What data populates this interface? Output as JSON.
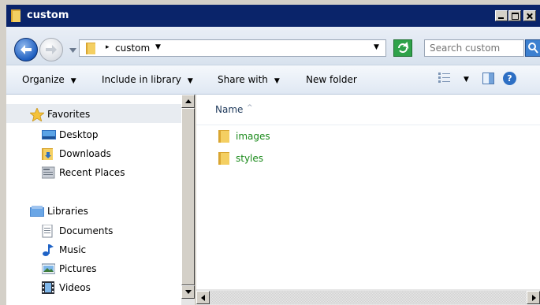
{
  "window": {
    "title": "custom"
  },
  "address": {
    "path_item": "custom"
  },
  "search": {
    "placeholder": "Search custom"
  },
  "toolbar": {
    "organize": "Organize",
    "include_in_library": "Include in library",
    "share_with": "Share with",
    "new_folder": "New folder",
    "help_glyph": "?"
  },
  "sidebar": {
    "favorites": {
      "label": "Favorites",
      "items": [
        {
          "label": "Desktop",
          "icon": "desktop-icon"
        },
        {
          "label": "Downloads",
          "icon": "downloads-folder-icon"
        },
        {
          "label": "Recent Places",
          "icon": "recent-places-icon"
        }
      ]
    },
    "libraries": {
      "label": "Libraries",
      "items": [
        {
          "label": "Documents",
          "icon": "documents-icon"
        },
        {
          "label": "Music",
          "icon": "music-icon"
        },
        {
          "label": "Pictures",
          "icon": "pictures-icon"
        },
        {
          "label": "Videos",
          "icon": "videos-icon"
        }
      ]
    }
  },
  "content": {
    "column_name": "Name",
    "files": [
      {
        "name": "images",
        "type": "folder"
      },
      {
        "name": "styles",
        "type": "folder"
      }
    ]
  },
  "colors": {
    "title_bar": "#0a246a",
    "file_name_text": "#1a8a1a",
    "favorites_highlight": "#e8ecf1"
  }
}
